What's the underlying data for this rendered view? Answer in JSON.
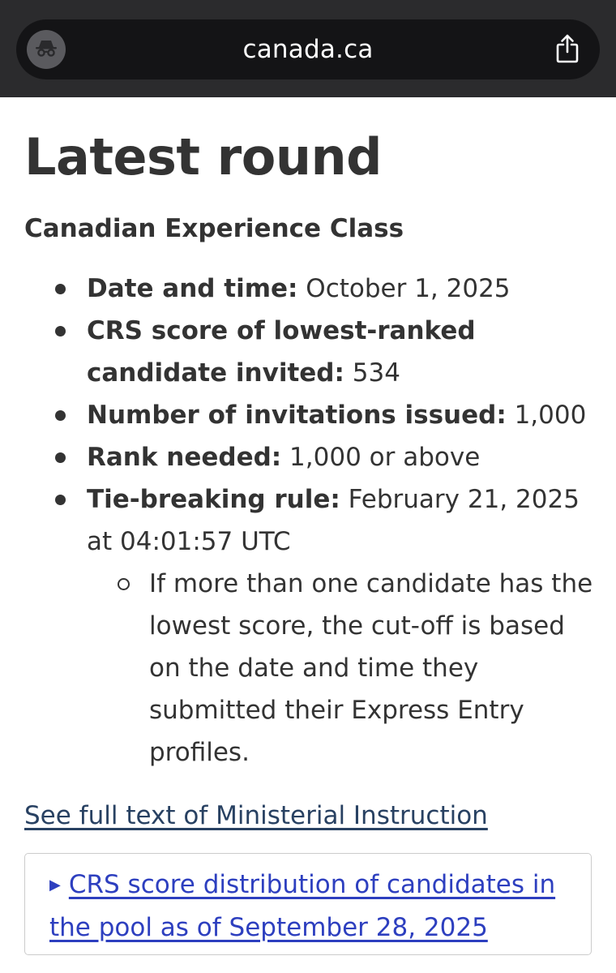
{
  "browser": {
    "url": "canada.ca",
    "incognito_icon": "incognito-icon",
    "share_icon": "share-icon"
  },
  "page": {
    "title": "Latest round",
    "section_heading": "Canadian Experience Class",
    "items": [
      {
        "label": "Date and time:",
        "value": " October 1, 2025"
      },
      {
        "label": "CRS score of lowest-ranked candidate invited:",
        "value": " 534"
      },
      {
        "label": "Number of invitations issued:",
        "value": " 1,000"
      },
      {
        "label": "Rank needed:",
        "value": " 1,000 or above"
      },
      {
        "label": "Tie-breaking rule:",
        "value": " February 21, 2025 at 04:01:57 UTC"
      }
    ],
    "tie_breaking_note": "If more than one candidate has the lowest score, the cut-off is based on the date and time they submitted their Express Entry profiles.",
    "ministerial_link": "See full text of Ministerial Instruction",
    "distribution_summary": "CRS score distribution of candidates in the pool as of September 28, 2025"
  },
  "colors": {
    "browser_bar": "#2b2b2d",
    "text": "#333333",
    "link": "#284162",
    "summary_link": "#2d3fbf"
  }
}
